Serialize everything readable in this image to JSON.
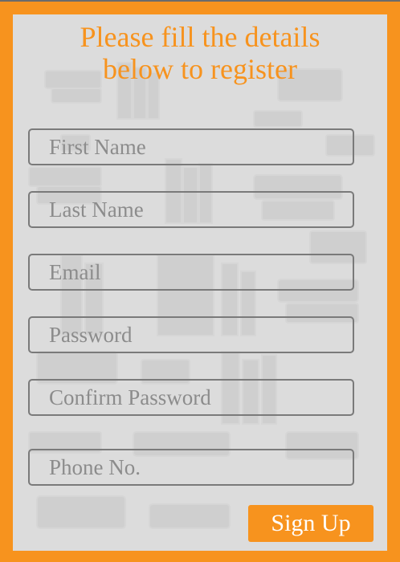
{
  "form": {
    "title_line1": "Please fill the details",
    "title_line2": "below to register",
    "fields": [
      {
        "placeholder": "First Name",
        "value": ""
      },
      {
        "placeholder": "Last Name",
        "value": ""
      },
      {
        "placeholder": "Email",
        "value": ""
      },
      {
        "placeholder": "Password",
        "value": ""
      },
      {
        "placeholder": "Confirm Password",
        "value": ""
      },
      {
        "placeholder": "Phone No.",
        "value": ""
      }
    ],
    "submit_label": "Sign Up"
  },
  "colors": {
    "accent": "#f7931e",
    "panel_background": "#dcdcdc",
    "field_border": "#7a7a7a",
    "placeholder_text": "#8c8c8c"
  },
  "icons": {
    "background_pattern": "books-pattern"
  }
}
